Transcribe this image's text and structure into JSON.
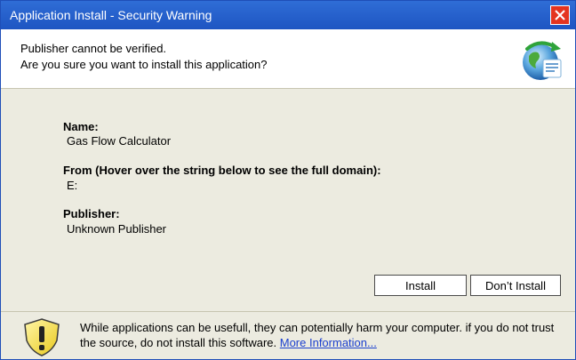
{
  "window": {
    "title": "Application Install - Security Warning"
  },
  "header": {
    "line1": "Publisher cannot be verified.",
    "line2": "Are you sure you want to install this application?"
  },
  "details": {
    "name_label": "Name:",
    "name_value": "Gas Flow Calculator",
    "from_label": "From (Hover over the string below to see the full domain):",
    "from_value": "E:",
    "publisher_label": "Publisher:",
    "publisher_value": "Unknown Publisher"
  },
  "buttons": {
    "install": "Install",
    "dont_install": "Don’t Install"
  },
  "footer": {
    "text": "While applications can be usefull, they can potentially harm your computer. if you do not trust the source, do not install this software.",
    "link": "More Information..."
  },
  "colors": {
    "titlebar": "#2f6dd6",
    "panel": "#ecebe0",
    "close": "#e4341f",
    "link": "#1a3fcf"
  }
}
